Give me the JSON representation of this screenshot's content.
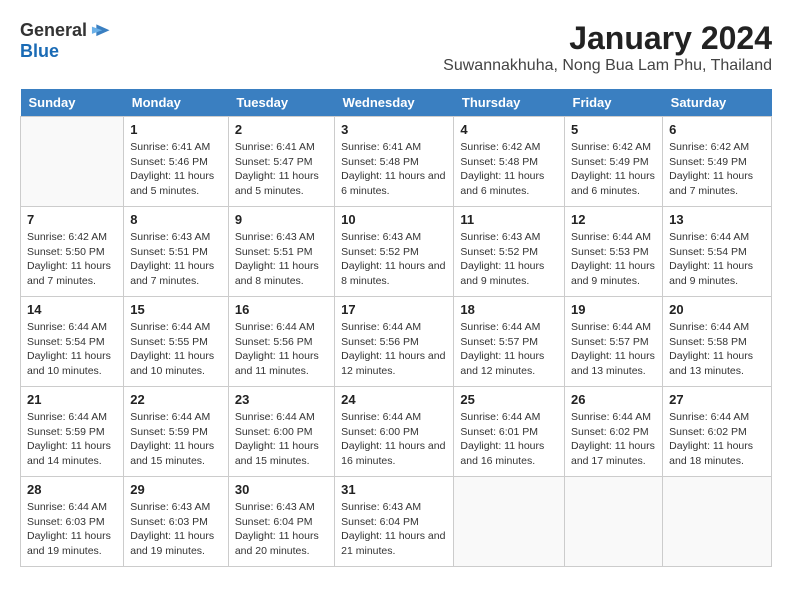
{
  "header": {
    "logo_general": "General",
    "logo_blue": "Blue",
    "main_title": "January 2024",
    "subtitle": "Suwannakhuha, Nong Bua Lam Phu, Thailand"
  },
  "calendar": {
    "weekdays": [
      "Sunday",
      "Monday",
      "Tuesday",
      "Wednesday",
      "Thursday",
      "Friday",
      "Saturday"
    ],
    "weeks": [
      [
        {
          "day": "",
          "sunrise": "",
          "sunset": "",
          "daylight": ""
        },
        {
          "day": "1",
          "sunrise": "Sunrise: 6:41 AM",
          "sunset": "Sunset: 5:46 PM",
          "daylight": "Daylight: 11 hours and 5 minutes."
        },
        {
          "day": "2",
          "sunrise": "Sunrise: 6:41 AM",
          "sunset": "Sunset: 5:47 PM",
          "daylight": "Daylight: 11 hours and 5 minutes."
        },
        {
          "day": "3",
          "sunrise": "Sunrise: 6:41 AM",
          "sunset": "Sunset: 5:48 PM",
          "daylight": "Daylight: 11 hours and 6 minutes."
        },
        {
          "day": "4",
          "sunrise": "Sunrise: 6:42 AM",
          "sunset": "Sunset: 5:48 PM",
          "daylight": "Daylight: 11 hours and 6 minutes."
        },
        {
          "day": "5",
          "sunrise": "Sunrise: 6:42 AM",
          "sunset": "Sunset: 5:49 PM",
          "daylight": "Daylight: 11 hours and 6 minutes."
        },
        {
          "day": "6",
          "sunrise": "Sunrise: 6:42 AM",
          "sunset": "Sunset: 5:49 PM",
          "daylight": "Daylight: 11 hours and 7 minutes."
        }
      ],
      [
        {
          "day": "7",
          "sunrise": "Sunrise: 6:42 AM",
          "sunset": "Sunset: 5:50 PM",
          "daylight": "Daylight: 11 hours and 7 minutes."
        },
        {
          "day": "8",
          "sunrise": "Sunrise: 6:43 AM",
          "sunset": "Sunset: 5:51 PM",
          "daylight": "Daylight: 11 hours and 7 minutes."
        },
        {
          "day": "9",
          "sunrise": "Sunrise: 6:43 AM",
          "sunset": "Sunset: 5:51 PM",
          "daylight": "Daylight: 11 hours and 8 minutes."
        },
        {
          "day": "10",
          "sunrise": "Sunrise: 6:43 AM",
          "sunset": "Sunset: 5:52 PM",
          "daylight": "Daylight: 11 hours and 8 minutes."
        },
        {
          "day": "11",
          "sunrise": "Sunrise: 6:43 AM",
          "sunset": "Sunset: 5:52 PM",
          "daylight": "Daylight: 11 hours and 9 minutes."
        },
        {
          "day": "12",
          "sunrise": "Sunrise: 6:44 AM",
          "sunset": "Sunset: 5:53 PM",
          "daylight": "Daylight: 11 hours and 9 minutes."
        },
        {
          "day": "13",
          "sunrise": "Sunrise: 6:44 AM",
          "sunset": "Sunset: 5:54 PM",
          "daylight": "Daylight: 11 hours and 9 minutes."
        }
      ],
      [
        {
          "day": "14",
          "sunrise": "Sunrise: 6:44 AM",
          "sunset": "Sunset: 5:54 PM",
          "daylight": "Daylight: 11 hours and 10 minutes."
        },
        {
          "day": "15",
          "sunrise": "Sunrise: 6:44 AM",
          "sunset": "Sunset: 5:55 PM",
          "daylight": "Daylight: 11 hours and 10 minutes."
        },
        {
          "day": "16",
          "sunrise": "Sunrise: 6:44 AM",
          "sunset": "Sunset: 5:56 PM",
          "daylight": "Daylight: 11 hours and 11 minutes."
        },
        {
          "day": "17",
          "sunrise": "Sunrise: 6:44 AM",
          "sunset": "Sunset: 5:56 PM",
          "daylight": "Daylight: 11 hours and 12 minutes."
        },
        {
          "day": "18",
          "sunrise": "Sunrise: 6:44 AM",
          "sunset": "Sunset: 5:57 PM",
          "daylight": "Daylight: 11 hours and 12 minutes."
        },
        {
          "day": "19",
          "sunrise": "Sunrise: 6:44 AM",
          "sunset": "Sunset: 5:57 PM",
          "daylight": "Daylight: 11 hours and 13 minutes."
        },
        {
          "day": "20",
          "sunrise": "Sunrise: 6:44 AM",
          "sunset": "Sunset: 5:58 PM",
          "daylight": "Daylight: 11 hours and 13 minutes."
        }
      ],
      [
        {
          "day": "21",
          "sunrise": "Sunrise: 6:44 AM",
          "sunset": "Sunset: 5:59 PM",
          "daylight": "Daylight: 11 hours and 14 minutes."
        },
        {
          "day": "22",
          "sunrise": "Sunrise: 6:44 AM",
          "sunset": "Sunset: 5:59 PM",
          "daylight": "Daylight: 11 hours and 15 minutes."
        },
        {
          "day": "23",
          "sunrise": "Sunrise: 6:44 AM",
          "sunset": "Sunset: 6:00 PM",
          "daylight": "Daylight: 11 hours and 15 minutes."
        },
        {
          "day": "24",
          "sunrise": "Sunrise: 6:44 AM",
          "sunset": "Sunset: 6:00 PM",
          "daylight": "Daylight: 11 hours and 16 minutes."
        },
        {
          "day": "25",
          "sunrise": "Sunrise: 6:44 AM",
          "sunset": "Sunset: 6:01 PM",
          "daylight": "Daylight: 11 hours and 16 minutes."
        },
        {
          "day": "26",
          "sunrise": "Sunrise: 6:44 AM",
          "sunset": "Sunset: 6:02 PM",
          "daylight": "Daylight: 11 hours and 17 minutes."
        },
        {
          "day": "27",
          "sunrise": "Sunrise: 6:44 AM",
          "sunset": "Sunset: 6:02 PM",
          "daylight": "Daylight: 11 hours and 18 minutes."
        }
      ],
      [
        {
          "day": "28",
          "sunrise": "Sunrise: 6:44 AM",
          "sunset": "Sunset: 6:03 PM",
          "daylight": "Daylight: 11 hours and 19 minutes."
        },
        {
          "day": "29",
          "sunrise": "Sunrise: 6:43 AM",
          "sunset": "Sunset: 6:03 PM",
          "daylight": "Daylight: 11 hours and 19 minutes."
        },
        {
          "day": "30",
          "sunrise": "Sunrise: 6:43 AM",
          "sunset": "Sunset: 6:04 PM",
          "daylight": "Daylight: 11 hours and 20 minutes."
        },
        {
          "day": "31",
          "sunrise": "Sunrise: 6:43 AM",
          "sunset": "Sunset: 6:04 PM",
          "daylight": "Daylight: 11 hours and 21 minutes."
        },
        {
          "day": "",
          "sunrise": "",
          "sunset": "",
          "daylight": ""
        },
        {
          "day": "",
          "sunrise": "",
          "sunset": "",
          "daylight": ""
        },
        {
          "day": "",
          "sunrise": "",
          "sunset": "",
          "daylight": ""
        }
      ]
    ]
  }
}
